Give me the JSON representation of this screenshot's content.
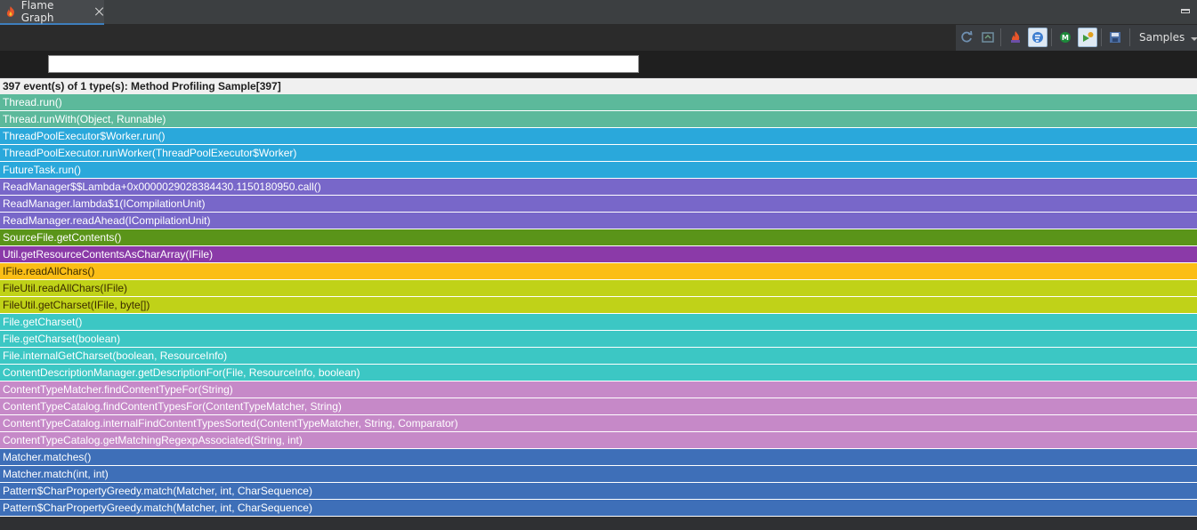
{
  "tab": {
    "title": "Flame Graph"
  },
  "toolbar": {
    "samples_label": "Samples",
    "buttons": [
      {
        "icon": "refresh-icon"
      },
      {
        "icon": "export-icon"
      },
      {
        "icon": "flame-view-icon"
      },
      {
        "icon": "icicle-view-icon"
      },
      {
        "icon": "method-icon"
      },
      {
        "icon": "run-icon"
      },
      {
        "icon": "save-icon"
      }
    ]
  },
  "search": {
    "value": "",
    "placeholder": ""
  },
  "summary": "397 event(s) of 1 type(s): Method Profiling Sample[397]",
  "colors": {
    "teal": "#5cb99b",
    "blue": "#2aa8db",
    "purple": "#7867c9",
    "green": "#5a9419",
    "magenta": "#8b3aa8",
    "orange": "#fbbe16",
    "lime": "#c0d218",
    "cyan": "#3cc7c4",
    "pink": "#c689c8",
    "steel": "#3e6fb8"
  },
  "frames": [
    {
      "label": "Thread.run()",
      "color": "teal"
    },
    {
      "label": "Thread.runWith(Object, Runnable)",
      "color": "teal"
    },
    {
      "label": "ThreadPoolExecutor$Worker.run()",
      "color": "blue"
    },
    {
      "label": "ThreadPoolExecutor.runWorker(ThreadPoolExecutor$Worker)",
      "color": "blue"
    },
    {
      "label": "FutureTask.run()",
      "color": "blue"
    },
    {
      "label": "ReadManager$$Lambda+0x0000029028384430.1150180950.call()",
      "color": "purple"
    },
    {
      "label": "ReadManager.lambda$1(ICompilationUnit)",
      "color": "purple"
    },
    {
      "label": "ReadManager.readAhead(ICompilationUnit)",
      "color": "purple"
    },
    {
      "label": "SourceFile.getContents()",
      "color": "green"
    },
    {
      "label": "Util.getResourceContentsAsCharArray(IFile)",
      "color": "magenta"
    },
    {
      "label": "IFile.readAllChars()",
      "color": "orange"
    },
    {
      "label": "FileUtil.readAllChars(IFile)",
      "color": "lime"
    },
    {
      "label": "FileUtil.getCharset(IFile, byte[])",
      "color": "lime"
    },
    {
      "label": "File.getCharset()",
      "color": "cyan"
    },
    {
      "label": "File.getCharset(boolean)",
      "color": "cyan"
    },
    {
      "label": "File.internalGetCharset(boolean, ResourceInfo)",
      "color": "cyan"
    },
    {
      "label": "ContentDescriptionManager.getDescriptionFor(File, ResourceInfo, boolean)",
      "color": "cyan"
    },
    {
      "label": "ContentTypeMatcher.findContentTypeFor(String)",
      "color": "pink"
    },
    {
      "label": "ContentTypeCatalog.findContentTypesFor(ContentTypeMatcher, String)",
      "color": "pink"
    },
    {
      "label": "ContentTypeCatalog.internalFindContentTypesSorted(ContentTypeMatcher, String, Comparator)",
      "color": "pink"
    },
    {
      "label": "ContentTypeCatalog.getMatchingRegexpAssociated(String, int)",
      "color": "pink"
    },
    {
      "label": "Matcher.matches()",
      "color": "steel"
    },
    {
      "label": "Matcher.match(int, int)",
      "color": "steel"
    },
    {
      "label": "Pattern$CharPropertyGreedy.match(Matcher, int, CharSequence)",
      "color": "steel"
    },
    {
      "label": "Pattern$CharPropertyGreedy.match(Matcher, int, CharSequence)",
      "color": "steel"
    }
  ]
}
